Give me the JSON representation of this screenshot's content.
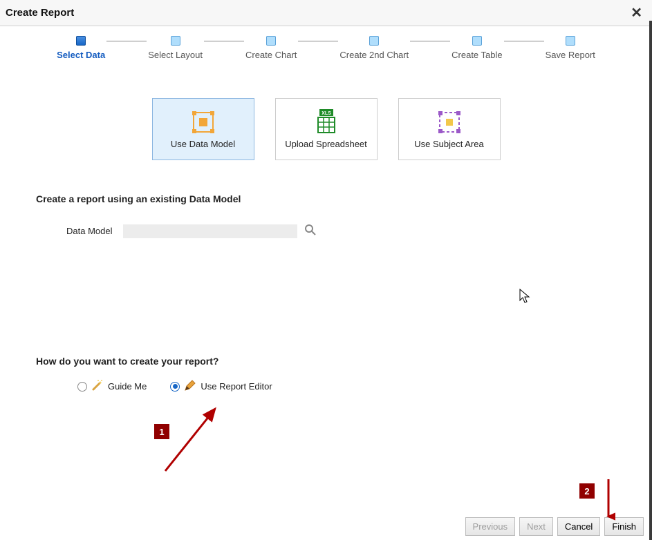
{
  "dialog": {
    "title": "Create Report"
  },
  "steps": [
    {
      "label": "Select Data",
      "active": true
    },
    {
      "label": "Select Layout",
      "active": false
    },
    {
      "label": "Create Chart",
      "active": false
    },
    {
      "label": "Create 2nd Chart",
      "active": false
    },
    {
      "label": "Create Table",
      "active": false
    },
    {
      "label": "Save Report",
      "active": false
    }
  ],
  "source_options": [
    {
      "label": "Use Data Model",
      "icon": "data-model-icon",
      "selected": true
    },
    {
      "label": "Upload Spreadsheet",
      "icon": "spreadsheet-icon",
      "selected": false
    },
    {
      "label": "Use Subject Area",
      "icon": "subject-area-icon",
      "selected": false
    }
  ],
  "data_model": {
    "section_title": "Create a report using an existing Data Model",
    "field_label": "Data Model",
    "value": ""
  },
  "how_create": {
    "section_title": "How do you want to create your report?",
    "options": [
      {
        "label": "Guide Me",
        "icon": "magic-wand-icon",
        "selected": false
      },
      {
        "label": "Use Report Editor",
        "icon": "pencil-icon",
        "selected": true
      }
    ]
  },
  "buttons": {
    "previous": "Previous",
    "next": "Next",
    "cancel": "Cancel",
    "finish": "Finish"
  },
  "annotations": {
    "badge1": "1",
    "badge2": "2"
  }
}
